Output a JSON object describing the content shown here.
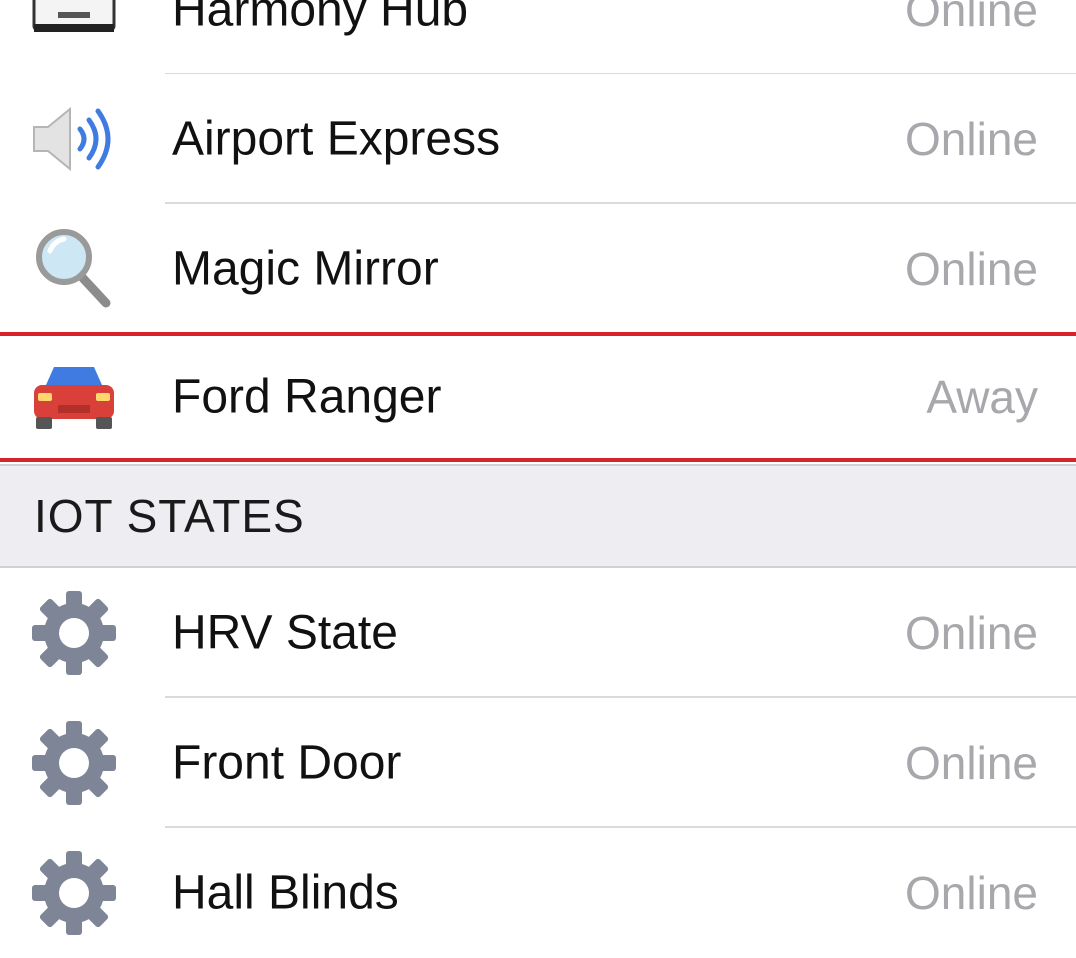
{
  "devices": [
    {
      "name": "Harmony Hub",
      "status": "Online",
      "icon": "hub-device-icon"
    },
    {
      "name": "Airport Express",
      "status": "Online",
      "icon": "speaker-icon"
    },
    {
      "name": "Magic Mirror",
      "status": "Online",
      "icon": "magnifying-glass-icon"
    },
    {
      "name": "Ford Ranger",
      "status": "Away",
      "icon": "car-icon"
    }
  ],
  "iot_section": {
    "title": "IOT STATES",
    "items": [
      {
        "name": "HRV State",
        "status": "Online",
        "icon": "gear-icon"
      },
      {
        "name": "Front Door",
        "status": "Online",
        "icon": "gear-icon"
      },
      {
        "name": "Hall Blinds",
        "status": "Online",
        "icon": "gear-icon"
      }
    ]
  },
  "colors": {
    "highlight": "#d8232a",
    "status_text": "#a7a7ac",
    "section_bg": "#eeeef2",
    "gear": "#7d8596",
    "car": "#d9403a"
  }
}
